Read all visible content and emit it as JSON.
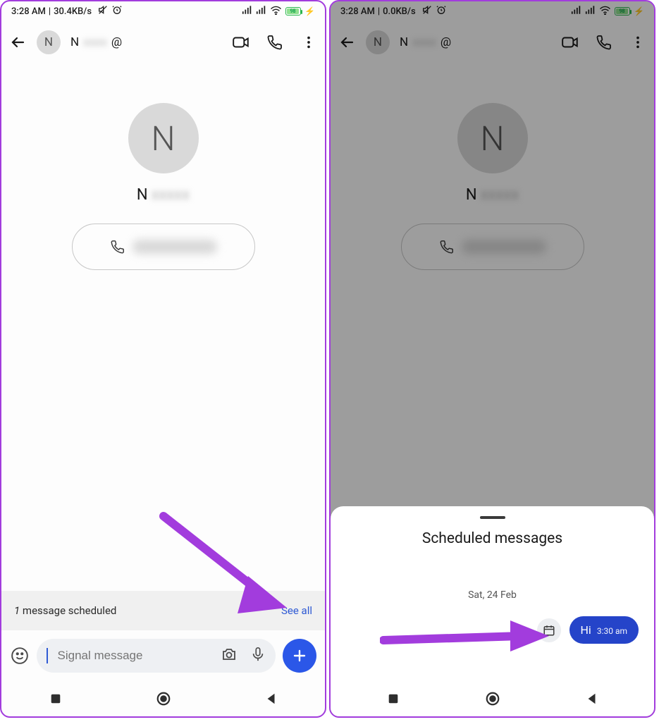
{
  "left": {
    "status": {
      "time": "3:28 AM",
      "sep": "|",
      "speed": "30.4KB/s",
      "battery": "98"
    },
    "header": {
      "contact_initial": "N",
      "contact_name": "N",
      "contact_tag": "@"
    },
    "profile": {
      "initial": "N",
      "name": "N"
    },
    "sched_bar": {
      "prefix": "1",
      "text": " message scheduled",
      "see_all": "See all"
    },
    "composer": {
      "placeholder": "Signal message"
    }
  },
  "right": {
    "status": {
      "time": "3:28 AM",
      "sep": "|",
      "speed": "0.0KB/s",
      "battery": "98"
    },
    "header": {
      "contact_initial": "N",
      "contact_name": "N",
      "contact_tag": "@"
    },
    "profile": {
      "initial": "N",
      "name": "N"
    },
    "sheet": {
      "title": "Scheduled messages",
      "date": "Sat, 24 Feb",
      "msg_text": "Hi",
      "msg_time": "3:30 am"
    }
  }
}
